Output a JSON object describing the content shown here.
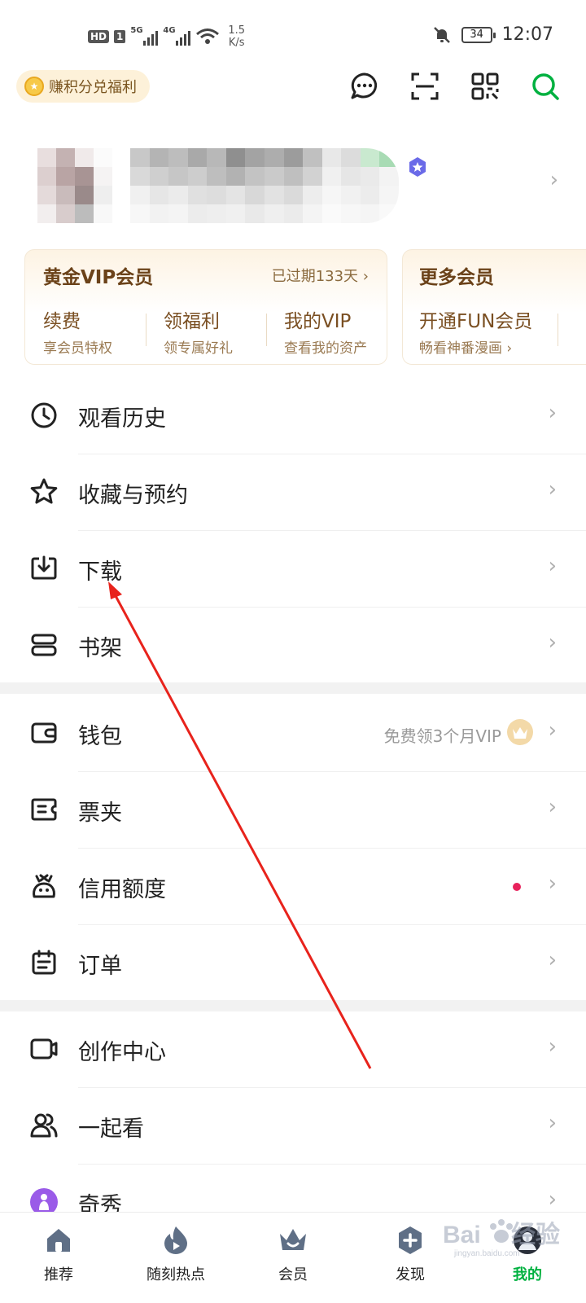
{
  "status_bar": {
    "hd": "HD",
    "sim": "1",
    "net1": "5G",
    "net2": "4G",
    "speed_value": "1.5",
    "speed_unit": "K/s",
    "battery": "34",
    "time": "12:07"
  },
  "header": {
    "points_label": "赚积分兑福利",
    "icons": [
      "message-icon",
      "scan-icon",
      "qr-code-icon",
      "search-icon"
    ]
  },
  "vip_card": {
    "title": "黄金VIP会员",
    "expired": "已过期133天",
    "items": [
      {
        "title": "续费",
        "sub": "享会员特权"
      },
      {
        "title": "领福利",
        "sub": "领专属好礼"
      },
      {
        "title": "我的VIP",
        "sub": "查看我的资产"
      }
    ]
  },
  "more_card": {
    "title": "更多会员",
    "item_title": "开通FUN会员",
    "item_sub": "畅看神番漫画"
  },
  "menu_group1": [
    {
      "label": "观看历史",
      "icon": "clock-icon"
    },
    {
      "label": "收藏与预约",
      "icon": "star-icon"
    },
    {
      "label": "下载",
      "icon": "download-icon"
    },
    {
      "label": "书架",
      "icon": "bookshelf-icon"
    }
  ],
  "menu_group2": [
    {
      "label": "钱包",
      "icon": "wallet-icon",
      "extra": "免费领3个月VIP"
    },
    {
      "label": "票夹",
      "icon": "ticket-icon"
    },
    {
      "label": "信用额度",
      "icon": "credit-icon"
    },
    {
      "label": "订单",
      "icon": "order-icon"
    }
  ],
  "menu_group3": [
    {
      "label": "创作中心",
      "icon": "camera-icon"
    },
    {
      "label": "一起看",
      "icon": "users-icon"
    },
    {
      "label": "奇秀",
      "icon": "qixiu-icon"
    }
  ],
  "tabbar": [
    {
      "label": "推荐",
      "icon": "home-icon"
    },
    {
      "label": "随刻热点",
      "icon": "flame-icon"
    },
    {
      "label": "会员",
      "icon": "crown-icon"
    },
    {
      "label": "发现",
      "icon": "discover-icon"
    },
    {
      "label": "我的",
      "icon": "profile-icon",
      "active": true
    }
  ],
  "colors": {
    "accent_green": "#00b140",
    "vip_brown": "#6b4219",
    "dot_red": "#e8225c",
    "arrow_red": "#e8231c"
  }
}
